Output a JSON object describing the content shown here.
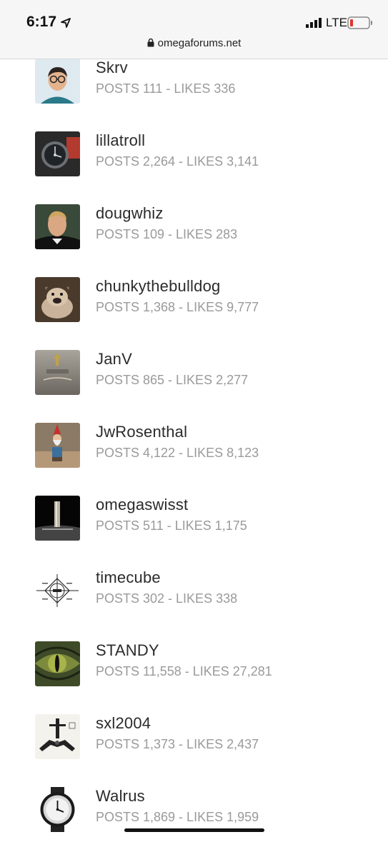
{
  "status_bar": {
    "time": "6:17",
    "network": "LTE",
    "url": "omegaforums.net"
  },
  "members": [
    {
      "username": "Skrv",
      "stats": "POSTS 111 - LIKES 336",
      "posts": 111,
      "likes": 336
    },
    {
      "username": "lillatroll",
      "stats": "POSTS 2,264 - LIKES 3,141",
      "posts": 2264,
      "likes": 3141
    },
    {
      "username": "dougwhiz",
      "stats": "POSTS 109 - LIKES 283",
      "posts": 109,
      "likes": 283
    },
    {
      "username": "chunkythebulldog",
      "stats": "POSTS 1,368 - LIKES 9,777",
      "posts": 1368,
      "likes": 9777
    },
    {
      "username": "JanV",
      "stats": "POSTS 865 - LIKES 2,277",
      "posts": 865,
      "likes": 2277
    },
    {
      "username": "JwRosenthal",
      "stats": "POSTS 4,122 - LIKES 8,123",
      "posts": 4122,
      "likes": 8123
    },
    {
      "username": "omegaswisst",
      "stats": "POSTS 511 - LIKES 1,175",
      "posts": 511,
      "likes": 1175
    },
    {
      "username": "timecube",
      "stats": "POSTS 302 - LIKES 338",
      "posts": 302,
      "likes": 338
    },
    {
      "username": "STANDY",
      "stats": "POSTS 11,558 - LIKES 27,281",
      "posts": 11558,
      "likes": 27281
    },
    {
      "username": "sxl2004",
      "stats": "POSTS 1,373 - LIKES 2,437",
      "posts": 1373,
      "likes": 2437
    },
    {
      "username": "Walrus",
      "stats": "POSTS 1,869 - LIKES 1,959",
      "posts": 1869,
      "likes": 1959
    }
  ],
  "colors": {
    "stats_gray": "#9a9a9a",
    "username": "#2b2b2b",
    "battery_low": "#e0332f"
  }
}
